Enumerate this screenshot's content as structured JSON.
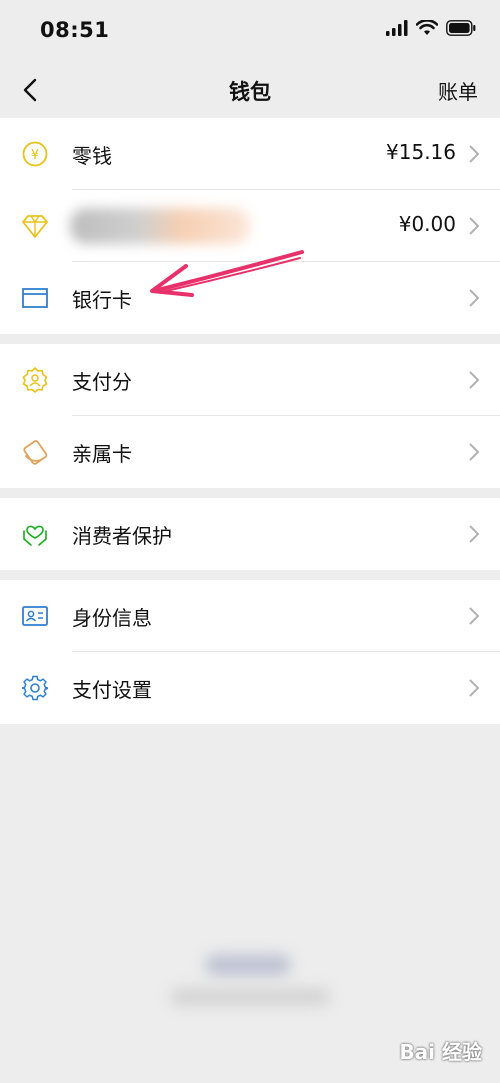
{
  "status_bar": {
    "time": "08:51"
  },
  "nav": {
    "title": "钱包",
    "right_action": "账单"
  },
  "groups": [
    {
      "items": [
        {
          "icon": "coin-yuan-icon",
          "label": "零钱",
          "value": "¥15.16"
        },
        {
          "icon": "diamond-icon",
          "label": "",
          "value": "¥0.00"
        },
        {
          "icon": "bank-card-icon",
          "label": "银行卡",
          "value": ""
        }
      ]
    },
    {
      "items": [
        {
          "icon": "credit-score-badge-icon",
          "label": "支付分",
          "value": ""
        },
        {
          "icon": "family-card-icon",
          "label": "亲属卡",
          "value": ""
        }
      ]
    },
    {
      "items": [
        {
          "icon": "protection-hands-icon",
          "label": "消费者保护",
          "value": ""
        }
      ]
    },
    {
      "items": [
        {
          "icon": "id-card-icon",
          "label": "身份信息",
          "value": ""
        },
        {
          "icon": "gear-icon",
          "label": "支付设置",
          "value": ""
        }
      ]
    }
  ],
  "watermark": {
    "text": "Bai 经验"
  },
  "colors": {
    "background": "#ededed",
    "surface": "#ffffff",
    "yellow_icon": "#e8c21a",
    "orange_icon": "#e0a35a",
    "green_icon": "#1aad19",
    "blue_icon": "#2f7fd0",
    "annotation_arrow": "#e8306a",
    "chevron": "#b2b2b2"
  }
}
